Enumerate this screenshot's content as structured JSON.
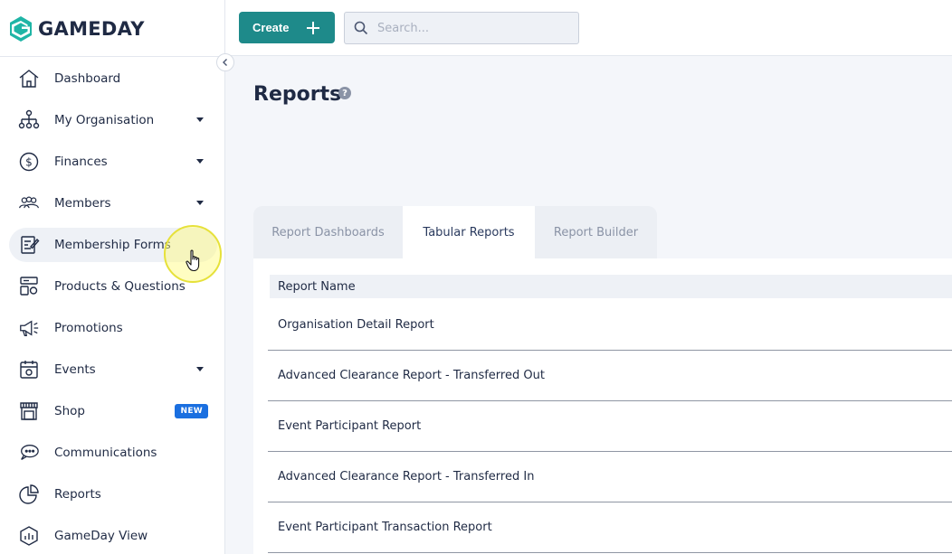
{
  "brand": {
    "name": "GAMEDAY",
    "accent": "#1e8a8a",
    "logo_colors": [
      "#1fb5a6",
      "#1f2a44"
    ]
  },
  "sidebar": {
    "items": [
      {
        "label": "Dashboard",
        "icon": "home-icon",
        "has_caret": false
      },
      {
        "label": "My Organisation",
        "icon": "org-chart-icon",
        "has_caret": true
      },
      {
        "label": "Finances",
        "icon": "dollar-icon",
        "has_caret": true
      },
      {
        "label": "Members",
        "icon": "members-icon",
        "has_caret": true
      },
      {
        "label": "Membership Forms",
        "icon": "form-icon",
        "has_caret": false,
        "active": true
      },
      {
        "label": "Products & Questions",
        "icon": "products-icon",
        "has_caret": false
      },
      {
        "label": "Promotions",
        "icon": "megaphone-icon",
        "has_caret": false
      },
      {
        "label": "Events",
        "icon": "calendar-icon",
        "has_caret": true
      },
      {
        "label": "Shop",
        "icon": "shop-icon",
        "has_caret": false,
        "badge": "NEW"
      },
      {
        "label": "Communications",
        "icon": "chat-icon",
        "has_caret": false
      },
      {
        "label": "Reports",
        "icon": "pie-chart-icon",
        "has_caret": false
      },
      {
        "label": "GameDay View",
        "icon": "gameday-view-icon",
        "has_caret": false
      }
    ]
  },
  "topbar": {
    "create_label": "Create",
    "search_placeholder": "Search..."
  },
  "main": {
    "title": "Reports",
    "tabs": [
      {
        "label": "Report Dashboards",
        "active": false
      },
      {
        "label": "Tabular Reports",
        "active": true
      },
      {
        "label": "Report Builder",
        "active": false
      }
    ],
    "table": {
      "header": "Report Name",
      "rows": [
        "Organisation Detail Report",
        "Advanced Clearance Report - Transferred Out",
        "Event Participant Report",
        "Advanced Clearance Report - Transferred In",
        "Event Participant Transaction Report"
      ]
    }
  }
}
